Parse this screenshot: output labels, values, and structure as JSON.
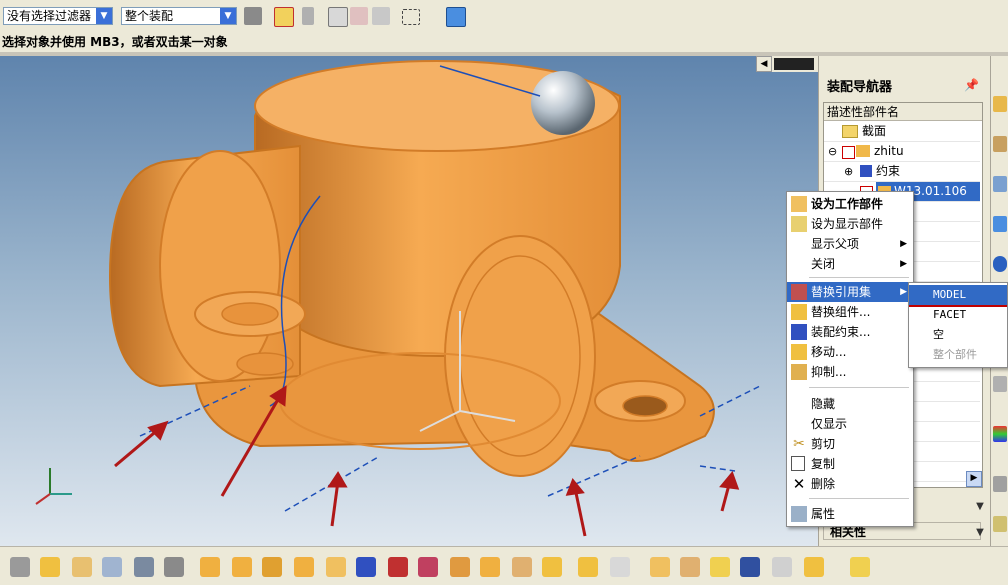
{
  "toolbar": {
    "filter_value": "没有选择过滤器",
    "scope_value": "整个装配"
  },
  "prompt": "选择对象并使用 MB3，或者双击某一对象",
  "navigator": {
    "title": "装配导航器",
    "column_header": "描述性部件名",
    "rows": [
      {
        "label": "截面"
      },
      {
        "label": "zhitu",
        "expander": "⊖"
      },
      {
        "label": "约束",
        "expander": "⊕"
      },
      {
        "label": "W13.01.106"
      }
    ],
    "related_header": "相关性"
  },
  "context_menu": {
    "items": [
      {
        "label": "设为工作部件",
        "bold": true
      },
      {
        "label": "设为显示部件"
      },
      {
        "label": "显示父项",
        "submenu": true
      },
      {
        "label": "关闭",
        "submenu": true
      },
      {
        "label": "替换引用集",
        "submenu": true,
        "highlighted": true
      },
      {
        "label": "替换组件..."
      },
      {
        "label": "装配约束..."
      },
      {
        "label": "移动..."
      },
      {
        "label": "抑制..."
      },
      {
        "label": "隐藏"
      },
      {
        "label": "仅显示"
      },
      {
        "label": "剪切"
      },
      {
        "label": "复制"
      },
      {
        "label": "删除"
      },
      {
        "label": "属性"
      }
    ]
  },
  "reference_submenu": {
    "items": [
      {
        "label": "MODEL",
        "highlighted": true
      },
      {
        "label": "FACET"
      },
      {
        "label": "空"
      },
      {
        "label": "整个部件",
        "disabled": true
      }
    ]
  },
  "colors": {
    "part_orange": "#f0a14a",
    "part_edge": "#d9822b",
    "menu_highlight": "#316ac5",
    "arrow_red": "#b01818",
    "datum_blue": "#1d4fb8"
  }
}
